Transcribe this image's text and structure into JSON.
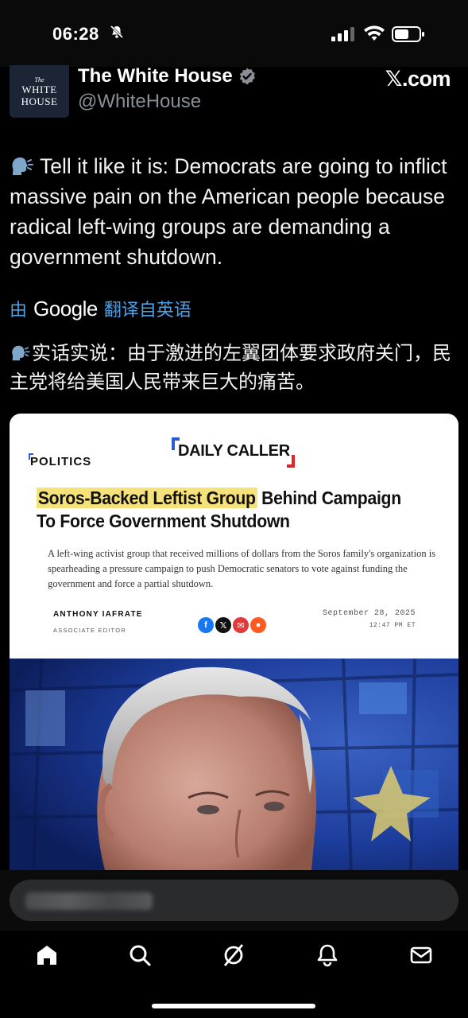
{
  "status": {
    "time": "06:28"
  },
  "account": {
    "avatar_lines": [
      "The",
      "WHITE",
      "HOUSE"
    ],
    "name": "The White House",
    "handle": "@WhiteHouse",
    "source": "𝕏.com"
  },
  "tweet": {
    "text": "Tell it like it is: Democrats are going to inflict massive pain on the American people because radical left-wing groups are demanding a government shutdown.",
    "translated_prefix": "由",
    "translated_brand": "Google",
    "translated_suffix": "翻译自英语",
    "translation": "实话实说：由于激进的左翼团体要求政府关门，民主党将给美国人民带来巨大的痛苦。"
  },
  "card": {
    "outlet": "DAILY CALLER",
    "section": "POLITICS",
    "headline_highlight": "Soros-Backed Leftist Group",
    "headline_rest": " Behind Campaign To Force Government Shutdown",
    "dek": "A left-wing activist group that received millions of dollars from the Soros family's organization is spearheading a pressure campaign to push Democratic senators to vote against funding the government and force a partial shutdown.",
    "author": "ANTHONY IAFRATE",
    "role": "ASSOCIATE EDITOR",
    "date": "September 28, 2025",
    "time": "12:47 PM ET",
    "share_colors": [
      "#1877f2",
      "#111111",
      "#e23a3a",
      "#ff5a1f"
    ]
  },
  "colors": {
    "accent": "#4aa3e8",
    "verified": "#8a8f96",
    "highlight": "#f6e27a"
  }
}
